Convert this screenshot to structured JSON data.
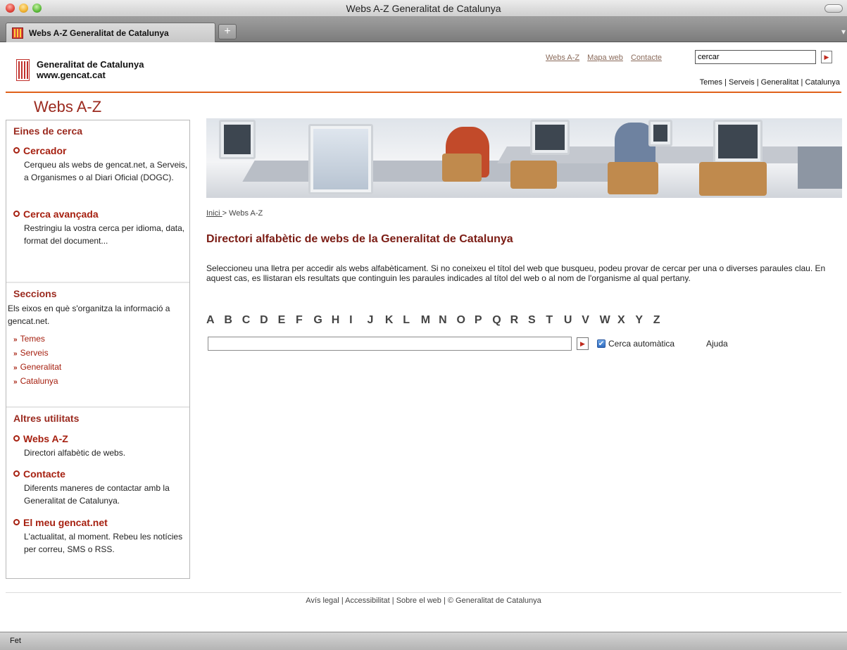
{
  "window": {
    "title": "Webs A-Z Generalitat de Catalunya",
    "tab_label": "Webs A-Z Generalitat de Catalunya",
    "new_tab": "+",
    "tab_menu": "▾"
  },
  "header": {
    "org_name": "Generalitat de Catalunya",
    "org_url": "www.gencat.cat",
    "links": [
      "Webs A-Z",
      "Mapa web",
      "Contacte"
    ],
    "search_value": "cercar",
    "search_button": "▶",
    "sections": [
      "Temes",
      "Serveis",
      "Generalitat",
      "Catalunya"
    ],
    "separator": "|"
  },
  "page_heading": "Webs A-Z",
  "sidebar": {
    "tools_heading": "Eines de cerca",
    "tools": [
      {
        "title": "Cercador",
        "desc": "Cerqueu als webs de gencat.net, a Serveis, a Organismes o al Diari Oficial (DOGC)."
      },
      {
        "title": "Cerca avançada",
        "desc": "Restringiu la vostra cerca per idioma, data, format del document..."
      }
    ],
    "sections_heading": "Seccions",
    "sections_desc": "Els eixos en què s'organitza la informació a gencat.net.",
    "sections_links": [
      "Temes",
      "Serveis",
      "Generalitat",
      "Catalunya"
    ],
    "other_heading": "Altres utilitats",
    "other": [
      {
        "title": "Webs A-Z",
        "desc": "Directori alfabètic de webs."
      },
      {
        "title": "Contacte",
        "desc": "Diferents maneres de contactar amb la Generalitat de Catalunya."
      },
      {
        "title": "El meu gencat.net",
        "desc": "L'actualitat, al moment. Rebeu les notícies per correu, SMS o RSS."
      }
    ],
    "link_arrow": "»"
  },
  "breadcrumb": {
    "home": "Inici ",
    "separator": "> ",
    "current": "Webs A-Z"
  },
  "main": {
    "title": "Directori alfabètic de webs de la Generalitat de Catalunya",
    "intro": "Seleccioneu una lletra per accedir als webs alfabèticament. Si no coneixeu el títol del web que busqueu, podeu provar de cercar per una o diverses paraules clau. En aquest cas, es llistaran els resultats que continguin les paraules indicades al títol del web o al nom de l'organisme al qual pertany.",
    "letters": [
      "A",
      "B",
      "C",
      "D",
      "E",
      "F",
      "G",
      "H",
      "I",
      "J",
      "K",
      "L",
      "M",
      "N",
      "O",
      "P",
      "Q",
      "R",
      "S",
      "T",
      "U",
      "V",
      "W",
      "X",
      "Y",
      "Z"
    ],
    "search_value": "",
    "search_button": "▶",
    "auto_search_label": "Cerca automàtica",
    "auto_search_checked": true,
    "check_mark": "✔",
    "help_link": "Ajuda"
  },
  "footer": {
    "links": [
      "Avís legal",
      "Accessibilitat",
      "Sobre el web",
      "© Generalitat de Catalunya"
    ],
    "separator": "|"
  },
  "status": "Fet",
  "colors": {
    "accent": "#9b2a1f",
    "link_red": "#a62010",
    "header_rule": "#e0611a"
  }
}
